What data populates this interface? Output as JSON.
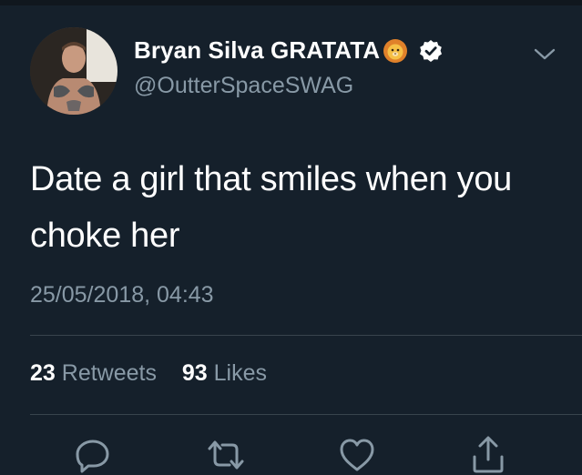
{
  "tweet": {
    "author": {
      "display_name": "Bryan Silva GRATATA",
      "handle": "@OutterSpaceSWAG",
      "emoji_icon": "lion-face-icon",
      "verified_icon": "verified-badge-icon"
    },
    "text_line1": "Date a girl that smiles when you",
    "text_line2": "choke her",
    "timestamp": "25/05/2018, 04:43",
    "stats": {
      "retweets_count": "23",
      "retweets_label": "Retweets",
      "likes_count": "93",
      "likes_label": "Likes"
    },
    "actions": [
      "reply-icon",
      "retweet-icon",
      "like-icon",
      "share-icon"
    ]
  },
  "colors": {
    "background": "#15202b",
    "primary_text": "#ffffff",
    "secondary_text": "#8899a6",
    "divider": "#38444d"
  }
}
